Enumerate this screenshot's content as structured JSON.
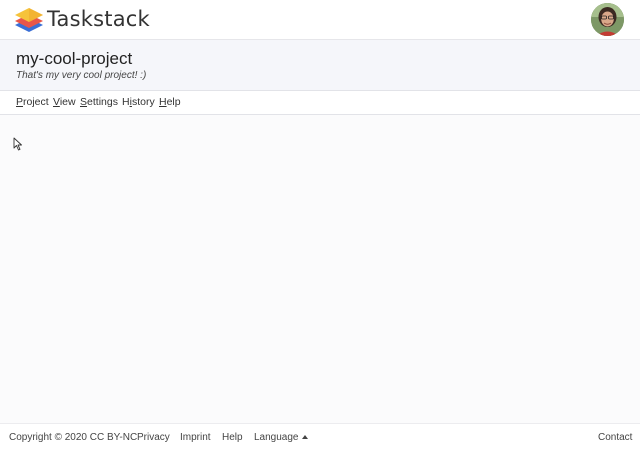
{
  "app": {
    "brand": "Taskstack",
    "logo_icon": "stacked-layers-logo",
    "avatar_icon": "user-avatar"
  },
  "project": {
    "title": "my-cool-project",
    "description": "That's my very cool project! :)"
  },
  "menu": {
    "items": [
      {
        "label": "Project",
        "mnemonic": "P"
      },
      {
        "label": "View",
        "mnemonic": "V"
      },
      {
        "label": "Settings",
        "mnemonic": "S"
      },
      {
        "label": "History",
        "mnemonic": "i"
      },
      {
        "label": "Help",
        "mnemonic": "H"
      }
    ]
  },
  "footer": {
    "copyright": "Copyright © 2020 CC BY-NC",
    "privacy": "Privacy",
    "imprint": "Imprint",
    "help": "Help",
    "language": "Language",
    "contact": "Contact"
  },
  "colors": {
    "logo_yellow": "#f6c33b",
    "logo_red": "#e8564a",
    "logo_blue": "#3a6fd6",
    "header_bg": "#f5f6fa"
  }
}
